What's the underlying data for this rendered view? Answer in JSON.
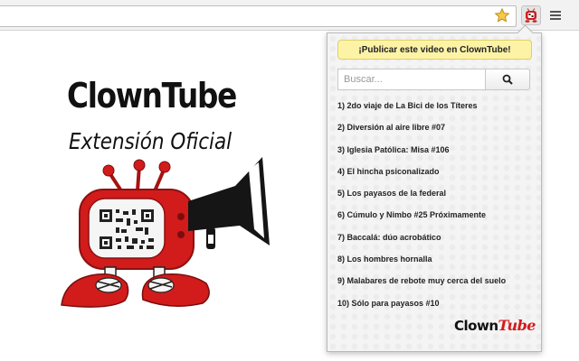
{
  "browser": {
    "address_value": "",
    "bookmark_icon": "star-icon",
    "extension_icon": "clowntube-tv-icon",
    "menu_icon": "hamburger-menu-icon"
  },
  "promo": {
    "title": "ClownTube",
    "subtitle": "Extensión Oficial",
    "mascot": "clown-tv-megaphone-mascot"
  },
  "popup": {
    "publish_label": "¡Publicar este video en ClownTube!",
    "search_placeholder": "Buscar...",
    "search_icon": "search-icon",
    "videos": [
      "1) 2do viaje de La Bici de los Títeres",
      "2) Diversión al aire libre #07",
      "3) Iglesia Patólica: Misa #106",
      "4) El hincha psiconalizado",
      "5) Los payasos de la federal",
      "6) Cúmulo y Nimbo #25 Próximamente",
      "7) Baccalá: dúo acrobático",
      "8) Los hombres hornalla",
      "9) Malabares de rebote muy cerca del suelo",
      "10) Sólo para payasos #10"
    ],
    "logo_part1": "Clown",
    "logo_part2": "Tube"
  },
  "colors": {
    "publish_bg": "#fdf3a7",
    "brand_red": "#d21b1b",
    "popup_bg": "#f4f4f4"
  }
}
